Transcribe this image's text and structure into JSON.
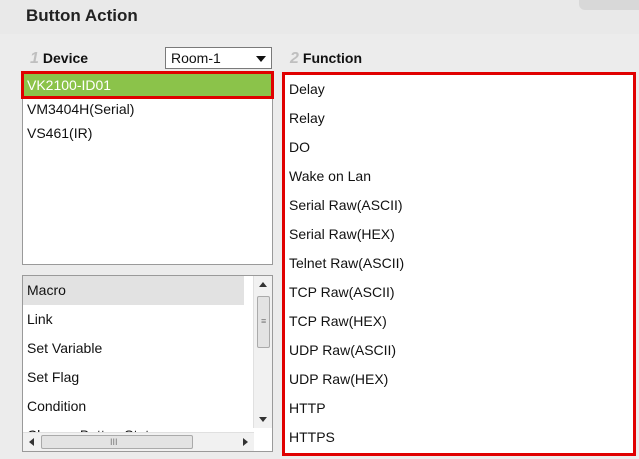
{
  "header": {
    "title": "Button Action"
  },
  "device_panel": {
    "step": "1",
    "label": "Device",
    "room_select": {
      "value": "Room-1"
    },
    "devices": [
      "VK2100-ID01",
      "VM3404H(Serial)",
      "VS461(IR)"
    ],
    "selected_index": 0
  },
  "function_panel": {
    "step": "2",
    "label": "Function",
    "items": [
      "Delay",
      "Relay",
      "DO",
      "Wake on Lan",
      "Serial Raw(ASCII)",
      "Serial Raw(HEX)",
      "Telnet Raw(ASCII)",
      "TCP Raw(ASCII)",
      "TCP Raw(HEX)",
      "UDP Raw(ASCII)",
      "UDP Raw(HEX)",
      "HTTP",
      "HTTPS"
    ]
  },
  "action_types": {
    "items": [
      "Macro",
      "Link",
      "Set Variable",
      "Set Flag",
      "Condition",
      "Change Button State"
    ],
    "active_index": 0,
    "scrollbar_grip": "≡",
    "hscroll_grip": "III"
  },
  "colors": {
    "selected_bg": "#8bc34a",
    "highlight_border": "#e00000"
  }
}
